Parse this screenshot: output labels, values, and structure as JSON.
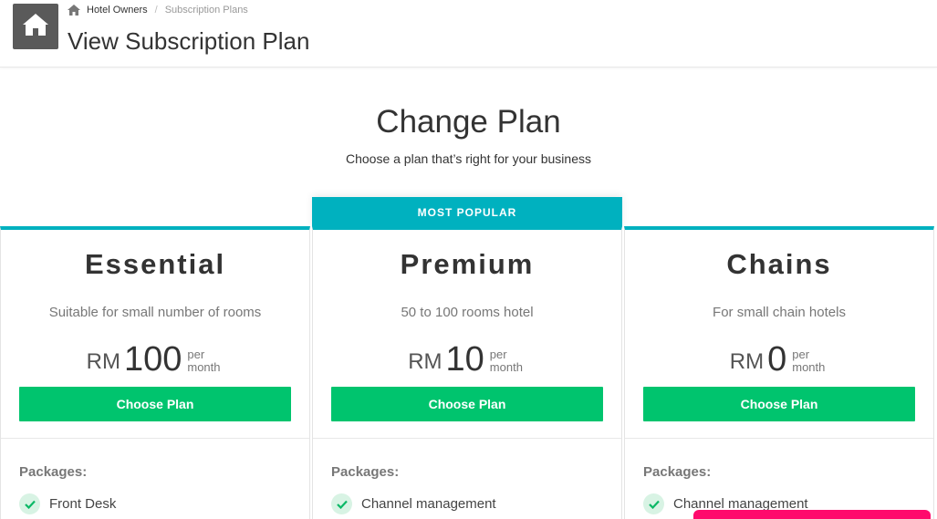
{
  "breadcrumb": {
    "home_label": "Hotel Owners",
    "current_label": "Subscription Plans",
    "separator": "/"
  },
  "header": {
    "title": "View Subscription Plan",
    "home_icon": "home-icon"
  },
  "hero": {
    "title": "Change Plan",
    "subtitle": "Choose a plan that’s right for your business"
  },
  "popular_badge": "MOST POPULAR",
  "plans": [
    {
      "name": "Essential",
      "description": "Suitable for small number of rooms",
      "currency": "RM",
      "amount": "100",
      "period": "per month",
      "button_label": "Choose Plan",
      "packages_label": "Packages:",
      "packages": [
        "Front Desk"
      ]
    },
    {
      "name": "Premium",
      "description": "50 to 100 rooms hotel",
      "currency": "RM",
      "amount": "10",
      "period": "per month",
      "button_label": "Choose Plan",
      "packages_label": "Packages:",
      "packages": [
        "Channel management"
      ]
    },
    {
      "name": "Chains",
      "description": "For small chain hotels",
      "currency": "RM",
      "amount": "0",
      "period": "per month",
      "button_label": "Choose Plan",
      "packages_label": "Packages:",
      "packages": [
        "Channel management"
      ]
    }
  ],
  "colors": {
    "accent_teal": "#00b1bf",
    "button_green": "#00c46e",
    "pink": "#ff0a6c",
    "tile_gray": "#5a5a5a"
  }
}
